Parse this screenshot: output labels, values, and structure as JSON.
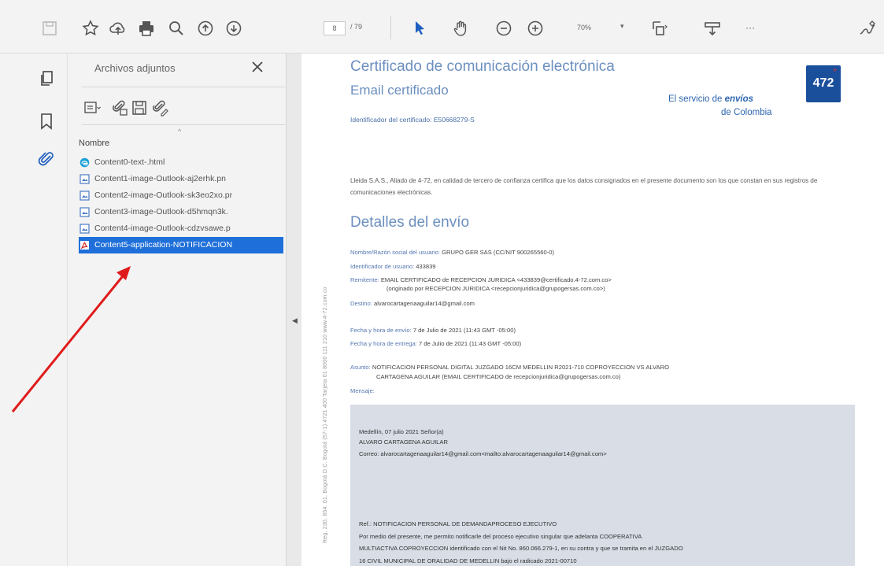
{
  "toolbar": {
    "page_current": "8",
    "page_total": "/ 79",
    "zoom": "70%",
    "zoom_caret": "▾",
    "more": "···"
  },
  "panel": {
    "title": "Archivos adjuntos",
    "column_header": "Nombre",
    "sort_caret": "^",
    "files": [
      {
        "name": "Content0-text-.html",
        "icon": "edge-icon",
        "selected": false
      },
      {
        "name": "Content1-image-Outlook-aj2erhk.pn",
        "icon": "image-file-icon",
        "selected": false
      },
      {
        "name": "Content2-image-Outlook-sk3eo2xo.pr",
        "icon": "image-file-icon",
        "selected": false
      },
      {
        "name": "Content3-image-Outlook-d5hmqn3k.",
        "icon": "image-file-icon",
        "selected": false
      },
      {
        "name": "Content4-image-Outlook-cdzvsawe.p",
        "icon": "image-file-icon",
        "selected": false
      },
      {
        "name": "Content5-application-NOTIFICACION",
        "icon": "pdf-icon",
        "selected": true
      }
    ]
  },
  "document": {
    "rotated_text": "Reg. 230, 854. 01, Bogotá D.C. Bogotá (57-1) 4721 400 Tarjeta 01 8000 111 210  www.4-72.com.co",
    "title_line1": "Certificado de comunicación electrónica",
    "title_line2": "Email certificado",
    "brand_prefix": "El servicio de ",
    "brand_bold": "envíos",
    "brand_line2": "de Colombia",
    "logo_text": "472",
    "certificate_id": "Identificador del certificado: E50668279-S",
    "intro": "Lleida S.A.S., Aliado de 4-72, en calidad de tercero de confianza certifica que los datos consignados en el presente documento son los que constan en sus registros de comunicaciones electrónicas.",
    "details_heading": "Detalles del envío",
    "details": [
      {
        "label": "Nombre/Razón social del usuario:",
        "value": "GRUPO GER SAS (CC/NIT 900265560-0)"
      },
      {
        "label": "Identificador de usuario:",
        "value": "433839"
      },
      {
        "label": "Remitente:",
        "value": "EMAIL CERTIFICADO de RECEPCION JURIDICA <433839@certificado.4-72.com.co>"
      },
      {
        "label": "",
        "value": "(originado por RECEPCION JURIDICA <recepcionjuridica@grupogersas.com.co>)"
      },
      {
        "label": "Destino:",
        "value": "alvarocartagenaaguilar14@gmail.com"
      },
      {
        "label": "Fecha y hora de envío:",
        "value": "7 de Julio de 2021 (11:43 GMT -05:00)"
      },
      {
        "label": "Fecha y hora de entrega:",
        "value": "7 de Julio de 2021 (11:43 GMT -05:00)"
      },
      {
        "label": "Asunto:",
        "value": "NOTIFICACION PERSONAL DIGITAL JUZGADO 16CM MEDELLIN R2021-710 COPROYECCION VS ALVARO"
      },
      {
        "label": "",
        "value": "CARTAGENA AGUILAR (EMAIL CERTIFICADO de recepcionjuridica@grupogersas.com.co)"
      }
    ],
    "message_label": "Mensaje:",
    "message_lines": [
      "Medellín, 07 julio 2021 Señor(a)",
      "ALVARO CARTAGENA AGUILAR",
      "Correo: alvarocartagenaaguilar14@gmail.com<mailto:alvarocartagenaaguilar14@gmail.com>",
      "Ref.: NOTIFICACION PERSONAL DE DEMANDAPROCESO EJECUTIVO",
      "Por medio del presente, me permito notificarle del proceso ejecutivo singular que adelanta COOPERATIVA",
      "MULTIACTIVA COPROYECCION identificado con el Nit No. 860.066.279-1, en su contra y que se tramita en el JUZGADO",
      "16 CIVIL MUNICIPAL DE ORALIDAD DE MEDELLIN bajo el radicado 2021-00710"
    ]
  },
  "colors": {
    "selection": "#1e6fd9",
    "title_blue": "#6c8fbf",
    "arrow": "#e01b1b",
    "message_bg": "#d8dde6"
  }
}
